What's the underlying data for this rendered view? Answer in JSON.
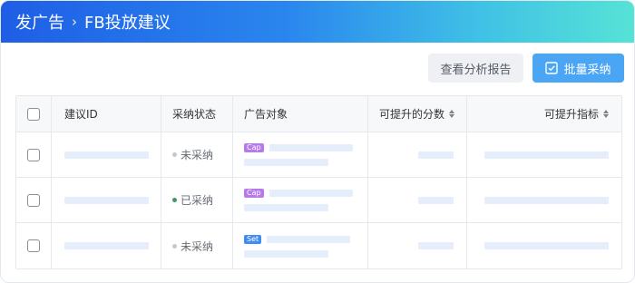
{
  "header": {
    "crumb1": "发广告",
    "sep": "›",
    "crumb2": "FB投放建议"
  },
  "toolbar": {
    "view_report": "查看分析报告",
    "batch_adopt": "批量采纳"
  },
  "table": {
    "columns": [
      "建议ID",
      "采纳状态",
      "广告对象",
      "可提升的分数",
      "可提升指标"
    ],
    "rows": [
      {
        "status": "未采纳",
        "status_color": "#c4c7cc",
        "tag": "Cap",
        "tag_color": "#b77aeb"
      },
      {
        "status": "已采纳",
        "status_color": "#3a9a64",
        "tag": "Cap",
        "tag_color": "#b77aeb"
      },
      {
        "status": "未采纳",
        "status_color": "#c4c7cc",
        "tag": "Set",
        "tag_color": "#3f8df0"
      }
    ]
  },
  "colors": {
    "header_gradient": [
      "#1e5ee6",
      "#56e3d6"
    ],
    "primary": "#4aa5f5",
    "placeholder": "#e7eefb"
  }
}
